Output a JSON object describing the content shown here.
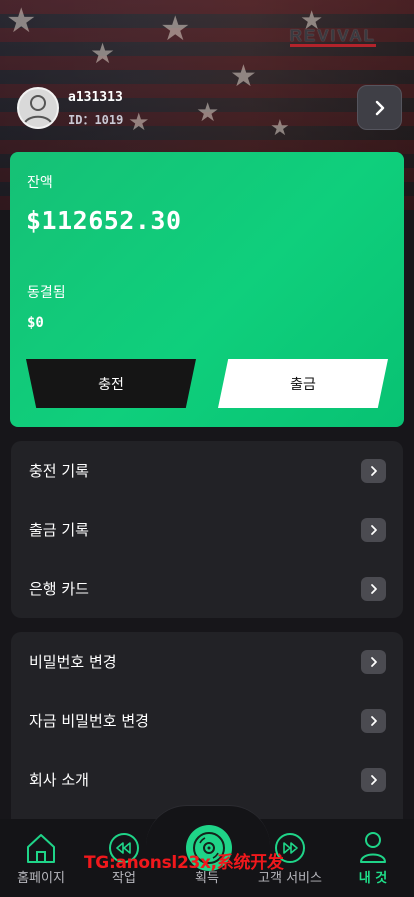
{
  "header": {
    "brand": "REVIVAL",
    "username": "a131313",
    "user_id": "ID：1019"
  },
  "balance_card": {
    "balance_label": "잔액",
    "balance_value": "$112652.30",
    "frozen_label": "동결됨",
    "frozen_value": "$0",
    "deposit_label": "충전",
    "withdraw_label": "출금"
  },
  "menu_group_1": [
    {
      "label": "충전 기록"
    },
    {
      "label": "출금 기록"
    },
    {
      "label": "은행 카드"
    }
  ],
  "menu_group_2": [
    {
      "label": "비밀번호 변경"
    },
    {
      "label": "자금 비밀번호 변경"
    },
    {
      "label": "회사 소개"
    }
  ],
  "tabs": [
    {
      "label": "홈페이지",
      "icon": "home-icon",
      "active": false
    },
    {
      "label": "작업",
      "icon": "rewind-icon",
      "active": false
    },
    {
      "label": "획득",
      "icon": "disc-icon",
      "active": false
    },
    {
      "label": "고객 서비스",
      "icon": "fast-forward-icon",
      "active": false
    },
    {
      "label": "내 것",
      "icon": "user-icon",
      "active": true
    }
  ],
  "watermark": "TG:anonsl23x,系统开发",
  "colors": {
    "accent_green": "#10c878",
    "active_tab": "#1fe08a",
    "watermark_red": "#f0181c",
    "background": "#17161a"
  }
}
